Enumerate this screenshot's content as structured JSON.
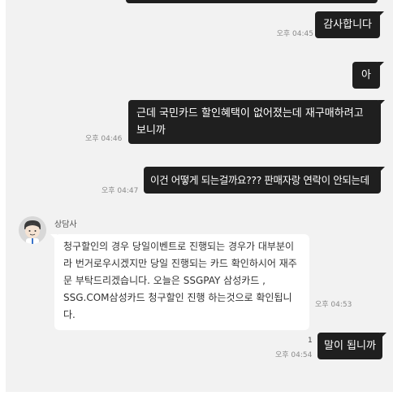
{
  "messages": [
    {
      "text": "감사합니다",
      "time": "오후 04:45"
    },
    {
      "text": "아"
    },
    {
      "text": "근데 국민카드 할인혜택이 없어졌는데 재구매하려고 보니까",
      "time": "오후 04:46"
    },
    {
      "text": "이건 어떻게 되는걸까요??? 판매자랑 연락이 안되는데",
      "time": "오후 04:47"
    },
    {
      "sender": "상담사",
      "text": "청구할인의 경우 당일이벤트로 진행되는 경우가 대부분이라 번거로우시겠지만 당일 진행되는 카드 확인하시어 재주문 부탁드리겠습니다. 오늘은 SSGPAY 삼성카드 , SSG.COM삼성카드 청구할인 진행 하는것으로 확인됩니다.",
      "time": "오후 04:53"
    },
    {
      "text": "말이 됩니까",
      "time": "오후 04:54",
      "unread": "1"
    }
  ],
  "colors": {
    "outgoing_bubble": "#1f1f1f",
    "incoming_bubble": "#ffffff",
    "background": "#f2f2f2"
  },
  "icons": {
    "avatar": "agent-avatar-icon"
  }
}
